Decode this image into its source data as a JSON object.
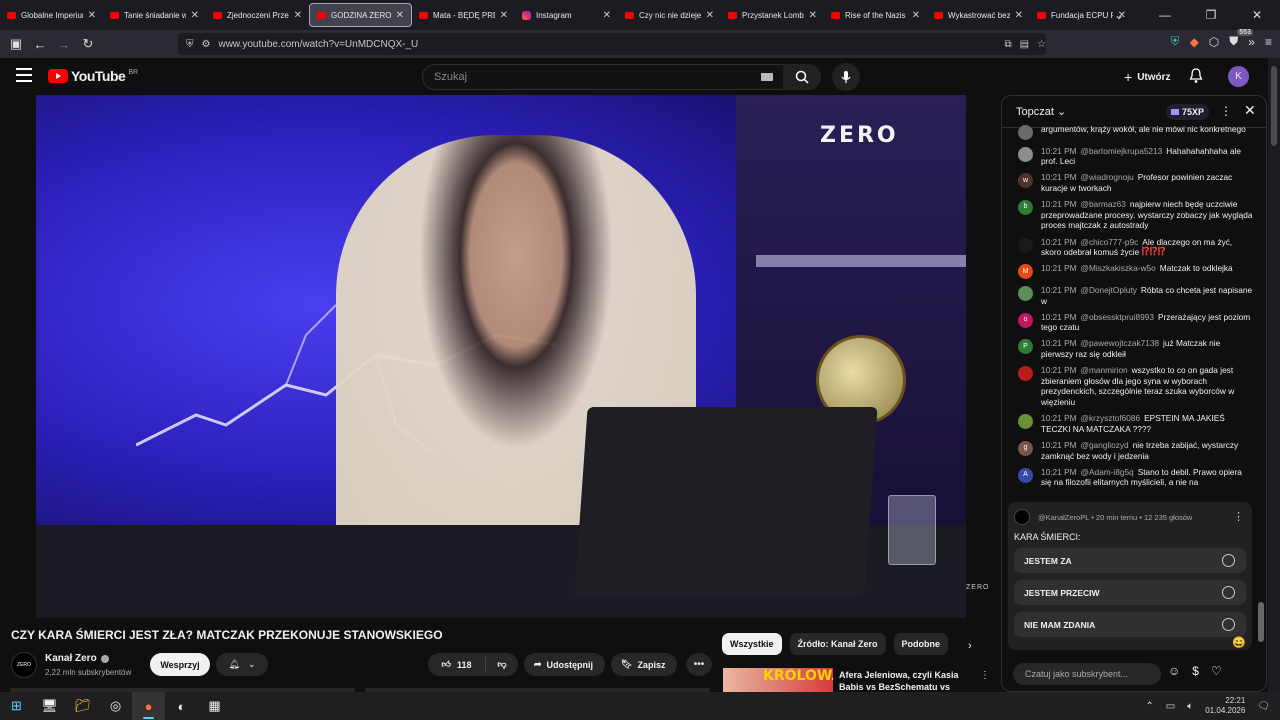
{
  "browser": {
    "tabs": [
      {
        "label": "Globalne Imperium",
        "icon": "youtube-icon"
      },
      {
        "label": "Tanie śniadanie w",
        "icon": "youtube-icon"
      },
      {
        "label": "Zjednoczeni Przec",
        "icon": "youtube-icon"
      },
      {
        "label": "GODZINA ZERO #",
        "icon": "youtube-icon",
        "active": true
      },
      {
        "label": "Mata - BĘDĘ PREZ",
        "icon": "youtube-icon"
      },
      {
        "label": "Instagram",
        "icon": "instagram-icon"
      },
      {
        "label": "Czy nic nie dzieje",
        "icon": "youtube-icon"
      },
      {
        "label": "Przystanek Lomba",
        "icon": "youtube-icon"
      },
      {
        "label": "Rise of the Nazis a",
        "icon": "youtube-icon"
      },
      {
        "label": "Wykastrować bez",
        "icon": "youtube-icon"
      },
      {
        "label": "Fundacja ECPU Po",
        "icon": "youtube-icon"
      }
    ],
    "url": "www.youtube.com/watch?v=UnMDCNQX-_U",
    "badge_count": "553"
  },
  "youtube": {
    "logo_text": "YouTube",
    "country_code": "BR",
    "search_placeholder": "Szukaj",
    "create_label": "Utwórz",
    "avatar_letter": "K"
  },
  "video": {
    "overlay_logo": "ZERO",
    "overlay_small": "ZERO",
    "title": "CZY KARA ŚMIERCI JEST ZŁA? MATCZAK PRZEKONUJE STANOWSKIEGO",
    "channel_name": "Kanał Zero",
    "channel_avatar_text": "ZERO",
    "subscribers": "2,22 mln subskrybentów",
    "support_label": "Wesprzyj",
    "likes": "118",
    "share_label": "Udostępnij",
    "save_label": "Zapisz"
  },
  "recommendations": {
    "chips": [
      "Wszystkie",
      "Źródło: Kanał Zero",
      "Podobne"
    ],
    "first": {
      "thumb_text": "KRÓLOWA",
      "title": "Afera Jeleniowa, czyli Kasia Babis vs BezSchematu vs ..."
    }
  },
  "chat": {
    "header_label": "Topczat",
    "xp_label": "75XP",
    "messages": [
      {
        "time": "",
        "author": "",
        "text": "argumentów, krąży wokół, ale nie mówi nic konkretnego",
        "avatar_color": "#6a6a6a",
        "avatar_letter": ""
      },
      {
        "time": "10:21 PM",
        "author": "@bartomiejkrupa5213",
        "text": "Hahahahahhaha ale prof. Leci",
        "avatar_color": "#8c8c8c",
        "avatar_letter": ""
      },
      {
        "time": "10:21 PM",
        "author": "@wiadrognoju",
        "text": "Profesor powinien zaczac kuracje w tworkach",
        "avatar_color": "#4e342e",
        "avatar_letter": "w"
      },
      {
        "time": "10:21 PM",
        "author": "@barmaz63",
        "text": "najpierw niech będę uczciwie przeprowadzane procesy. wystarczy zobaczy jak wygląda proces majtczak z autostrady",
        "avatar_color": "#2e7d32",
        "avatar_letter": "b"
      },
      {
        "time": "10:21 PM",
        "author": "@chico777-p9c",
        "text": "Ale dlaczego on ma żyć, skoro odebrał komuś życie",
        "emoji": "⁉⁉⁉",
        "avatar_color": "#1a1a1a",
        "avatar_letter": ""
      },
      {
        "time": "10:21 PM",
        "author": "@Miszkakiszka-w5o",
        "text": "Matczak to odklejka",
        "avatar_color": "#e64a19",
        "avatar_letter": "M"
      },
      {
        "time": "10:21 PM",
        "author": "@DonejtOpluty",
        "text": "Róbta co chceta jest napisane w",
        "avatar_color": "#5a8f5a",
        "avatar_letter": ""
      },
      {
        "time": "10:21 PM",
        "author": "@obsesskt​prui8993",
        "text": "Przerażający jest poziom tego czatu",
        "avatar_color": "#c2185b",
        "avatar_letter": "o"
      },
      {
        "time": "10:21 PM",
        "author": "@pawewojtczak7138",
        "text": "już Matczak nie pierwszy raz się odkleił",
        "avatar_color": "#2e7d32",
        "avatar_letter": "P"
      },
      {
        "time": "10:21 PM",
        "author": "@manmirion",
        "text": "wszystko to co on gada jest zbieraniem głosów dla jego syna w wyborach prezydenckich, szczególnie teraz szuka wyborców w więzieniu",
        "avatar_color": "#b71c1c",
        "avatar_letter": ""
      },
      {
        "time": "10:21 PM",
        "author": "@krzysztof6086",
        "text": "EPSTEIN MA JAKIEŚ TECZKI NA MATCZAKA ????",
        "avatar_color": "#6d8f3a",
        "avatar_letter": ""
      },
      {
        "time": "10:21 PM",
        "author": "@gangliozyd",
        "text": "nie trzeba zabijać, wystarczy zamknąć bez wody i jedzenia",
        "avatar_color": "#795548",
        "avatar_letter": "g"
      },
      {
        "time": "10:21 PM",
        "author": "@Adam-i8g5q",
        "text": "Stano to debil. Prawo opiera się na filozofii elitarnych myślicieli, a nie na",
        "avatar_color": "#3949ab",
        "avatar_letter": "A"
      }
    ],
    "poll": {
      "meta": "@KanałZeroPL • 20 min temu • 12 235 głosów",
      "question": "KARA ŚMIERCI:",
      "options": [
        "JESTEM ZA",
        "JESTEM PRZECIW",
        "NIE MAM ZDANIA"
      ]
    },
    "input_placeholder": "Czatuj jako subskrybent..."
  },
  "taskbar": {
    "time": "22:21",
    "date": "01.04.2026"
  }
}
